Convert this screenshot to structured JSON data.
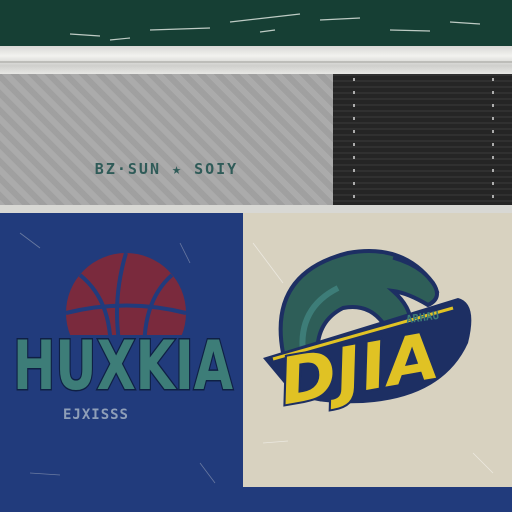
{
  "colors": {
    "top_band": "#163f34",
    "gray_panel": "#a6a6a6",
    "black_panel": "#252525",
    "blue_panel": "#213b7c",
    "cream_panel": "#d8d2c0",
    "teal": "#3d7d78",
    "maroon": "#7a2a3d",
    "yellow": "#e0c224",
    "navy": "#1d2f63"
  },
  "band": {
    "wordmark": "BZ·SUN ★ SOIY"
  },
  "left_logo": {
    "title": "HUXKIA",
    "subtitle": "EJXISSS",
    "icon": "basketball-icon"
  },
  "right_logo": {
    "title": "DJIA",
    "small_text": "ARHAU",
    "icon": "lobster-claw-icon"
  }
}
